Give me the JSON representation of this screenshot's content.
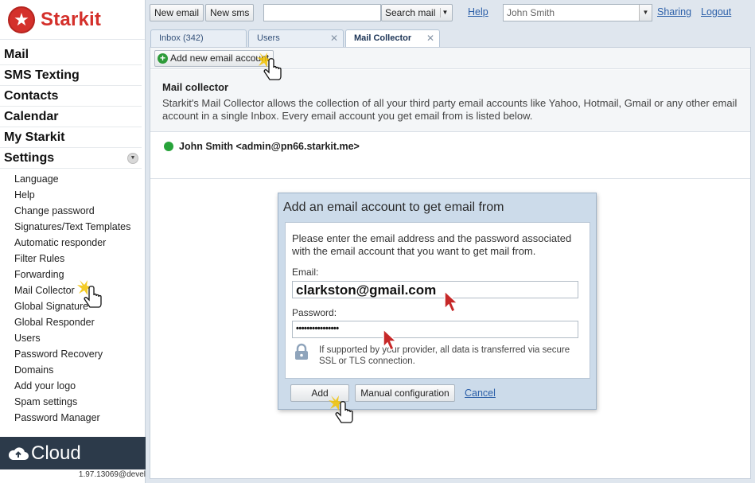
{
  "brand": {
    "name": "Starkit"
  },
  "sidebar": {
    "main_items": [
      {
        "label": "Mail"
      },
      {
        "label": "SMS Texting"
      },
      {
        "label": "Contacts"
      },
      {
        "label": "Calendar"
      },
      {
        "label": "My Starkit"
      },
      {
        "label": "Settings"
      }
    ],
    "settings_items": [
      {
        "label": "Language"
      },
      {
        "label": "Help"
      },
      {
        "label": "Change password"
      },
      {
        "label": "Signatures/Text Templates"
      },
      {
        "label": "Automatic responder"
      },
      {
        "label": "Filter Rules"
      },
      {
        "label": "Forwarding"
      },
      {
        "label": "Mail Collector"
      },
      {
        "label": "Global Signature"
      },
      {
        "label": "Global Responder"
      },
      {
        "label": "Users"
      },
      {
        "label": "Password Recovery"
      },
      {
        "label": "Domains"
      },
      {
        "label": "Add your logo"
      },
      {
        "label": "Spam settings"
      },
      {
        "label": "Password Manager"
      }
    ],
    "cloud_label": "Cloud",
    "version": "1.97.13069@devel"
  },
  "topbar": {
    "new_email": "New email",
    "new_sms": "New sms",
    "search_value": "",
    "search_button": "Search mail",
    "help": "Help",
    "user": "John Smith",
    "sharing": "Sharing",
    "logout": "Logout"
  },
  "tabs": [
    {
      "label": "Inbox (342)"
    },
    {
      "label": "Users"
    },
    {
      "label": "Mail Collector"
    }
  ],
  "toolbar": {
    "add_account": "Add new email account"
  },
  "info": {
    "title": "Mail collector",
    "description": "Starkit's Mail Collector allows the collection of all your third party email accounts like Yahoo, Hotmail, Gmail or any other email account in a single Inbox. Every email account you get email from is listed below."
  },
  "account": {
    "label": "John Smith <admin@pn66.starkit.me>",
    "status_color": "#27a33a"
  },
  "dialog": {
    "title": "Add an email account to get email from",
    "intro": "Please enter the email address and the password associated with the email account that you want to get mail from.",
    "email_label": "Email:",
    "email_value": "clarkston@gmail.com",
    "password_label": "Password:",
    "password_value": "••••••••••••••••",
    "secure_note": "If supported by your provider, all data is transferred via secure SSL or TLS connection.",
    "add": "Add",
    "manual": "Manual configuration",
    "cancel": "Cancel"
  },
  "colors": {
    "brand_red": "#d4302b",
    "link_blue": "#2b5fa8",
    "sidebar_dark": "#2c3a4a"
  }
}
